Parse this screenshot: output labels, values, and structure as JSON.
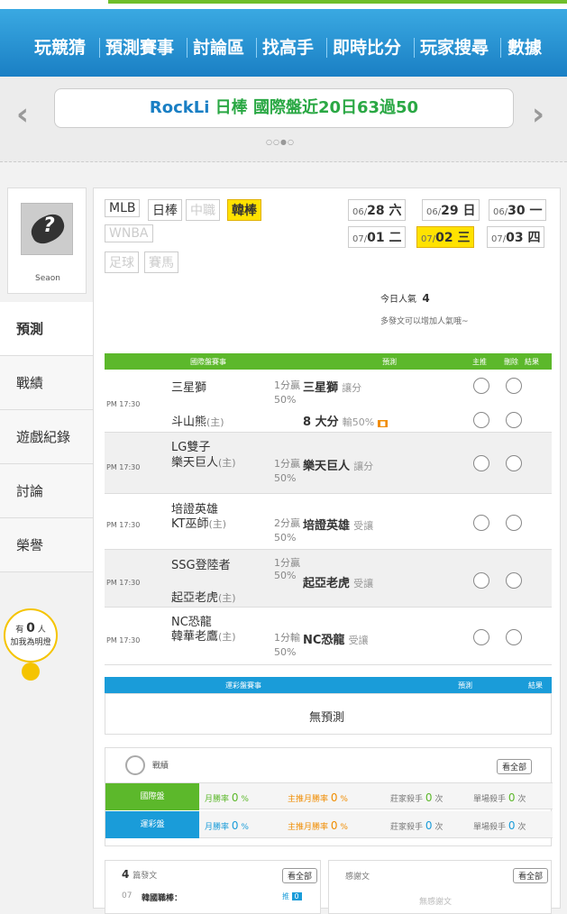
{
  "nav": {
    "items": [
      "玩競猜",
      "預測賽事",
      "討論區",
      "找高手",
      "即時比分",
      "玩家搜尋",
      "數據"
    ]
  },
  "ticker": {
    "name": "RockLi",
    "headline": " 日棒 國際盤近20日63過50",
    "dots": "○○●○"
  },
  "user": {
    "name": "Seaon"
  },
  "sidebar": {
    "items": [
      "預測",
      "戰績",
      "遊戲紀錄",
      "討論",
      "榮譽"
    ],
    "fans_prefix": "有",
    "fans_count": "0",
    "fans_suffix": "人",
    "fans_note": "加我為明燈"
  },
  "sports": [
    {
      "label": "MLB",
      "state": "normal"
    },
    {
      "label": "日棒",
      "state": "normal"
    },
    {
      "label": "中職",
      "state": "dim"
    },
    {
      "label": "韓棒",
      "state": "selected"
    },
    {
      "label": "WNBA",
      "state": "dim"
    },
    {
      "label": "足球",
      "state": "dim"
    },
    {
      "label": "賽馬",
      "state": "dim"
    }
  ],
  "dates": [
    {
      "m": "06/",
      "d": "28 六",
      "hl": false
    },
    {
      "m": "06/",
      "d": "29 日",
      "hl": false
    },
    {
      "m": "06/",
      "d": "30 一",
      "hl": false
    },
    {
      "m": "07/",
      "d": "01 二",
      "hl": false
    },
    {
      "m": "07/",
      "d": "02 三",
      "hl": true
    },
    {
      "m": "07/",
      "d": "03 四",
      "hl": false
    }
  ],
  "popularity": {
    "label": "今日人氣",
    "value": "4",
    "note": "多發文可以增加人氣哦~"
  },
  "intl": {
    "headers": [
      "國際盤賽事",
      "預測",
      "主推",
      "刪除",
      "結果"
    ],
    "games": [
      {
        "time": "PM 17:30",
        "away": "三星獅",
        "home": "斗山熊",
        "host": "(主)",
        "line1": "1分贏",
        "line2": "50%",
        "pick": "三星獅",
        "pick_note": "讓分",
        "pick2": "8 大分",
        "pick2_note": "輸50%"
      },
      {
        "time": "PM 17:30",
        "away": "LG雙子",
        "home": "樂天巨人",
        "host": "(主)",
        "line1": "1分贏",
        "line2": "50%",
        "pick": "樂天巨人",
        "pick_note": "讓分"
      },
      {
        "time": "PM 17:30",
        "away": "培證英雄",
        "home": "KT巫師",
        "host": "(主)",
        "line1": "2分贏",
        "line2": "50%",
        "pick": "培證英雄",
        "pick_note": "受讓"
      },
      {
        "time": "PM 17:30",
        "away": "SSG登陸者",
        "home": "起亞老虎",
        "host": "(主)",
        "line1": "1分贏",
        "line2": "50%",
        "pick": "起亞老虎",
        "pick_note": "受讓"
      },
      {
        "time": "PM 17:30",
        "away": "NC恐龍",
        "home": "韓華老鷹",
        "host": "(主)",
        "line1": "1分輸",
        "line2": "50%",
        "pick": "NC恐龍",
        "pick_note": "受讓"
      }
    ]
  },
  "lottery": {
    "headers": [
      "運彩盤賽事",
      "預測",
      "結果"
    ],
    "empty": "無預測"
  },
  "record": {
    "title": "戰績",
    "view_all": "看全部",
    "rows": [
      {
        "badge": "國際盤",
        "c1": "月勝率",
        "v1": "0",
        "u1": "%",
        "c2": "主推月勝率",
        "v2": "0",
        "u2": "%",
        "c3": "莊家殺手",
        "v3": "0",
        "u3": "次",
        "c4": "單場殺手",
        "v4": "0",
        "u4": "次"
      },
      {
        "badge": "運彩盤",
        "c1": "月勝率",
        "v1": "0",
        "u1": "%",
        "c2": "主推月勝率",
        "v2": "0",
        "u2": "%",
        "c3": "莊家殺手",
        "v3": "0",
        "u3": "次",
        "c4": "單場殺手",
        "v4": "0",
        "u4": "次"
      }
    ]
  },
  "posts": {
    "count": "4",
    "label": "篇發文",
    "view_all": "看全部",
    "first_date": "07",
    "first_title": "韓國職棒：",
    "push": "推",
    "push_count": "0"
  },
  "thanks": {
    "label": "感謝文",
    "view_all": "看全部",
    "empty": "無感謝文"
  },
  "colors": {
    "green": "#5cb82b",
    "blue": "#1a9cd9",
    "yellow": "#ffe200",
    "orange": "#f08c00"
  }
}
